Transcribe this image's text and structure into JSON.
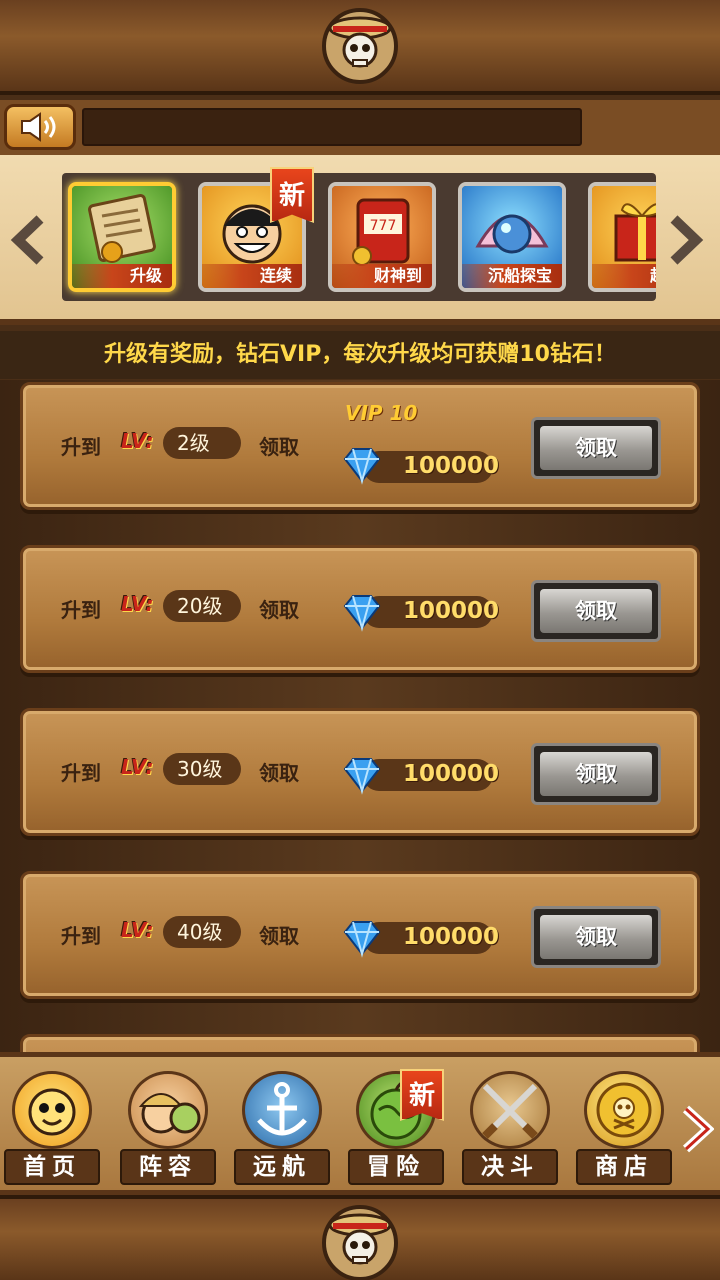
{
  "carousel": {
    "items": [
      {
        "label": "升级",
        "icon": "scroll-icon",
        "active": true
      },
      {
        "label": "连续",
        "icon": "luffy-icon",
        "badge": "新"
      },
      {
        "label": "财神到",
        "icon": "slot-machine-icon"
      },
      {
        "label": "沉船探宝",
        "icon": "pearl-shell-icon"
      },
      {
        "label": "超级",
        "icon": "gift-box-icon"
      }
    ]
  },
  "banner": "升级有奖励，钻石VIP，每次升级均可获赠10钻石！",
  "rewards": [
    {
      "to": "升到",
      "lv_tag": "LV:",
      "level": "2级",
      "claim_text": "领取",
      "vip": "VIP 10",
      "amount": "100000",
      "button": "领取"
    },
    {
      "to": "升到",
      "lv_tag": "LV:",
      "level": "20级",
      "claim_text": "领取",
      "amount": "100000",
      "button": "领取"
    },
    {
      "to": "升到",
      "lv_tag": "LV:",
      "level": "30级",
      "claim_text": "领取",
      "amount": "100000",
      "button": "领取"
    },
    {
      "to": "升到",
      "lv_tag": "LV:",
      "level": "40级",
      "claim_text": "领取",
      "amount": "100000",
      "button": "领取"
    }
  ],
  "nav": {
    "items": [
      {
        "label": "首页",
        "icon": "sunny-figurehead-icon"
      },
      {
        "label": "阵容",
        "icon": "crew-icon"
      },
      {
        "label": "远航",
        "icon": "anchor-icon"
      },
      {
        "label": "冒险",
        "icon": "devil-fruit-icon",
        "badge": "新"
      },
      {
        "label": "决斗",
        "icon": "crossed-swords-icon"
      },
      {
        "label": "商店",
        "icon": "gold-coin-icon"
      }
    ]
  },
  "colors": {
    "banner_text": "#ffd84a",
    "badge_red": "#c8451a",
    "amount_gold": "#ffdc6a"
  }
}
